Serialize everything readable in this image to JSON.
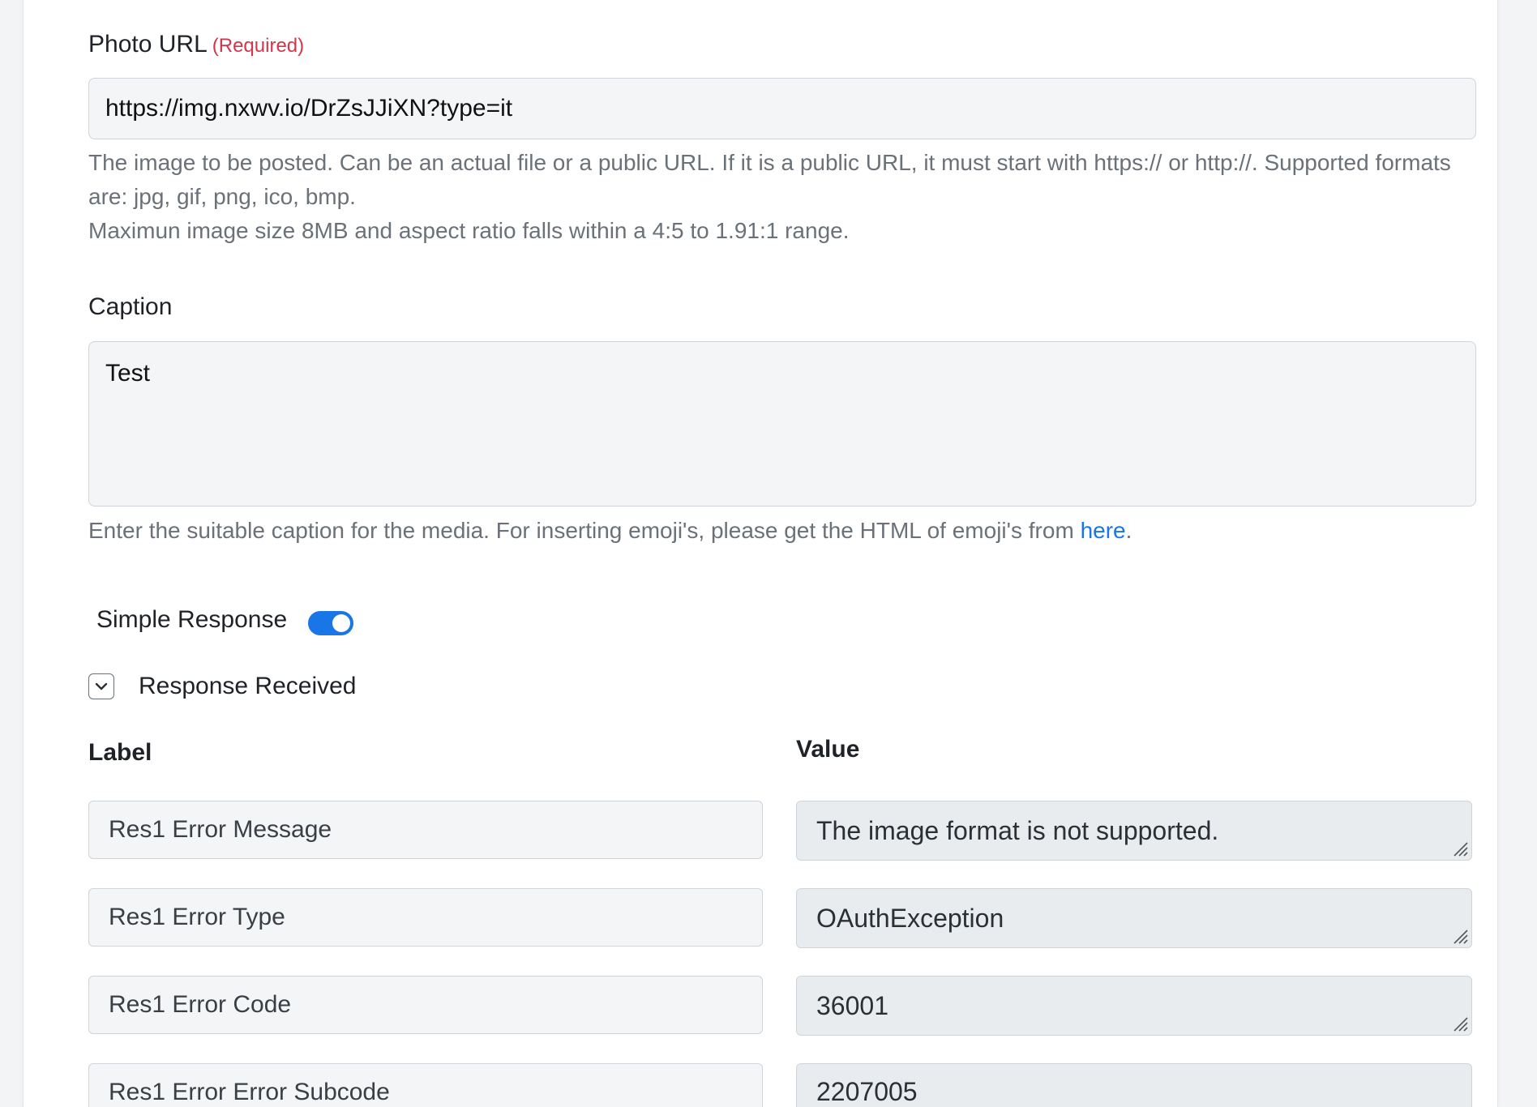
{
  "photo_url": {
    "label": "Photo URL",
    "required_text": "(Required)",
    "value": "https://img.nxwv.io/DrZsJJiXN?type=it",
    "help_line1": "The image to be posted. Can be an actual file or a public URL. If it is a public URL, it must start with https:// or http://. Supported formats are: jpg, gif, png, ico, bmp.",
    "help_line2": "Maximun image size 8MB and aspect ratio falls within a 4:5 to 1.91:1 range."
  },
  "caption": {
    "label": "Caption",
    "value": "Test",
    "help_text": "Enter the suitable caption for the media. For inserting emoji's, please get the HTML of emoji's from ",
    "help_link": "here",
    "help_end": "."
  },
  "simple_response": {
    "label": "Simple Response",
    "enabled": true
  },
  "response_received": {
    "label": "Response Received",
    "expanded": true,
    "label_header": "Label",
    "value_header": "Value",
    "rows": [
      {
        "label": "Res1 Error Message",
        "value": "The image format is not supported."
      },
      {
        "label": "Res1 Error Type",
        "value": "OAuthException"
      },
      {
        "label": "Res1 Error Code",
        "value": "36001"
      },
      {
        "label": "Res1 Error Error Subcode",
        "value": "2207005"
      }
    ]
  },
  "colors": {
    "accent": "#1976e6",
    "required": "#d3364a",
    "help_text": "#6b7178"
  }
}
